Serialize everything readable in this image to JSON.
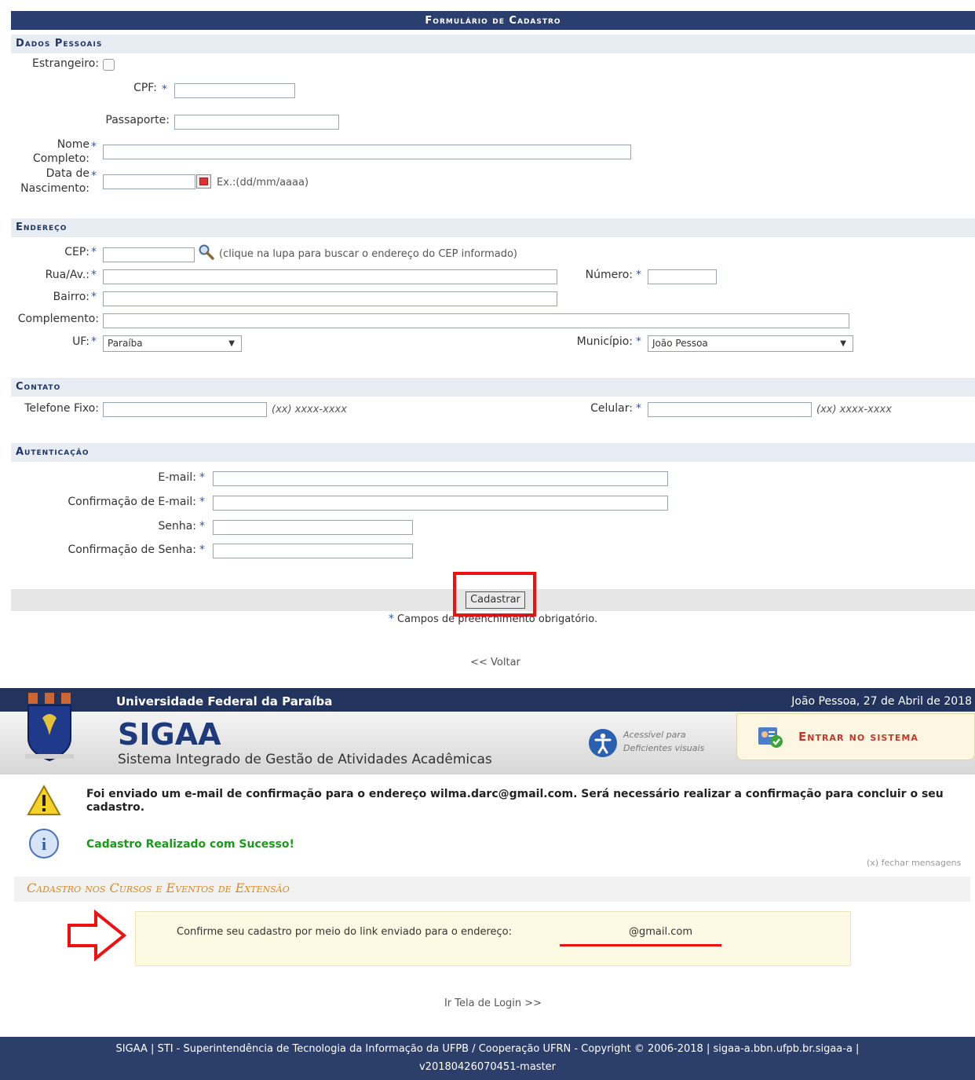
{
  "form": {
    "title": "Formulário de Cadastro",
    "required_star": "*",
    "dados_pessoais": {
      "header": "Dados Pessoais",
      "estrangeiro_label": "Estrangeiro:",
      "cpf_label": "CPF:",
      "passaporte_label": "Passaporte:",
      "nome_label_1": "Nome",
      "nome_label_2": "Completo:",
      "data_label_1": "Data de",
      "data_label_2": "Nascimento:",
      "data_hint": "Ex.:(dd/mm/aaaa)"
    },
    "endereco": {
      "header": "Endereço",
      "cep_label": "CEP:",
      "cep_hint": "(clique na lupa para buscar o endereço do CEP informado)",
      "rua_label": "Rua/Av.:",
      "numero_label": "Número:",
      "bairro_label": "Bairro:",
      "complemento_label": "Complemento:",
      "uf_label": "UF:",
      "uf_value": "Paraíba",
      "municipio_label": "Município:",
      "municipio_value": "João Pessoa"
    },
    "contato": {
      "header": "Contato",
      "telefone_label": "Telefone Fixo:",
      "telefone_hint": "(xx) xxxx-xxxx",
      "celular_label": "Celular:",
      "celular_hint": "(xx) xxxx-xxxx"
    },
    "autenticacao": {
      "header": "Autenticação",
      "email_label": "E-mail:",
      "email_conf_label": "Confirmação de E-mail:",
      "senha_label": "Senha:",
      "senha_conf_label": "Confirmação de Senha:"
    },
    "submit_label": "Cadastrar",
    "required_note": "Campos de preenchimento obrigatório.",
    "voltar": "<< Voltar"
  },
  "sigaa": {
    "university": "Universidade Federal da Paraíba",
    "date": "João Pessoa, 27 de Abril de 2018",
    "brand": "SIGAA",
    "brand_sub": "Sistema Integrado de Gestão de Atividades Acadêmicas",
    "access_1": "Acessível para",
    "access_2": "Deficientes visuais",
    "enter": "Entrar no sistema",
    "warning": "Foi enviado um e-mail de confirmação para o endereço wilma.darc@gmail.com. Será necessário realizar a confirmação para concluir o seu cadastro.",
    "success": "Cadastro Realizado com Sucesso!",
    "close_msg": "(x) fechar mensagens",
    "section_title": "Cadastro nos Cursos e Eventos de Extensão",
    "confirm_text": "Confirme seu cadastro por meio do link enviado para o endereço:",
    "confirm_email": "@gmail.com",
    "login_link": "Ir Tela de Login >>",
    "footer_1": "SIGAA | STI - Superintendência de Tecnologia da Informação da UFPB / Cooperação UFRN - Copyright © 2006-2018 | sigaa-a.bbn.ufpb.br.sigaa-a |",
    "footer_2": "v20180426070451-master"
  },
  "colors": {
    "navy": "#2a3f6e",
    "required": "#2b57b8",
    "highlight": "#e11111",
    "success": "#1a9a1a",
    "section_orange": "#d98a1f"
  }
}
